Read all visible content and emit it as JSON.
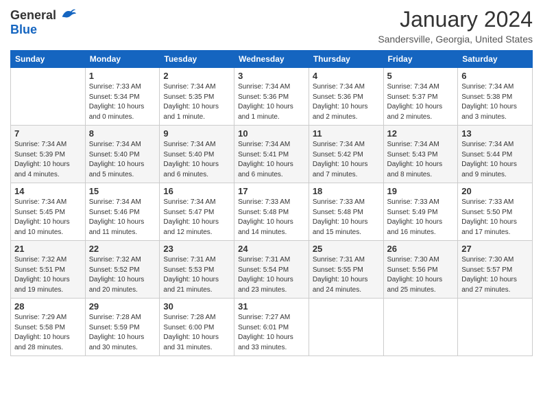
{
  "header": {
    "logo_general": "General",
    "logo_blue": "Blue",
    "month_title": "January 2024",
    "location": "Sandersville, Georgia, United States"
  },
  "weekdays": [
    "Sunday",
    "Monday",
    "Tuesday",
    "Wednesday",
    "Thursday",
    "Friday",
    "Saturday"
  ],
  "rows": [
    [
      {
        "day": "",
        "info": ""
      },
      {
        "day": "1",
        "info": "Sunrise: 7:33 AM\nSunset: 5:34 PM\nDaylight: 10 hours\nand 0 minutes."
      },
      {
        "day": "2",
        "info": "Sunrise: 7:34 AM\nSunset: 5:35 PM\nDaylight: 10 hours\nand 1 minute."
      },
      {
        "day": "3",
        "info": "Sunrise: 7:34 AM\nSunset: 5:36 PM\nDaylight: 10 hours\nand 1 minute."
      },
      {
        "day": "4",
        "info": "Sunrise: 7:34 AM\nSunset: 5:36 PM\nDaylight: 10 hours\nand 2 minutes."
      },
      {
        "day": "5",
        "info": "Sunrise: 7:34 AM\nSunset: 5:37 PM\nDaylight: 10 hours\nand 2 minutes."
      },
      {
        "day": "6",
        "info": "Sunrise: 7:34 AM\nSunset: 5:38 PM\nDaylight: 10 hours\nand 3 minutes."
      }
    ],
    [
      {
        "day": "7",
        "info": "Sunrise: 7:34 AM\nSunset: 5:39 PM\nDaylight: 10 hours\nand 4 minutes."
      },
      {
        "day": "8",
        "info": "Sunrise: 7:34 AM\nSunset: 5:40 PM\nDaylight: 10 hours\nand 5 minutes."
      },
      {
        "day": "9",
        "info": "Sunrise: 7:34 AM\nSunset: 5:40 PM\nDaylight: 10 hours\nand 6 minutes."
      },
      {
        "day": "10",
        "info": "Sunrise: 7:34 AM\nSunset: 5:41 PM\nDaylight: 10 hours\nand 6 minutes."
      },
      {
        "day": "11",
        "info": "Sunrise: 7:34 AM\nSunset: 5:42 PM\nDaylight: 10 hours\nand 7 minutes."
      },
      {
        "day": "12",
        "info": "Sunrise: 7:34 AM\nSunset: 5:43 PM\nDaylight: 10 hours\nand 8 minutes."
      },
      {
        "day": "13",
        "info": "Sunrise: 7:34 AM\nSunset: 5:44 PM\nDaylight: 10 hours\nand 9 minutes."
      }
    ],
    [
      {
        "day": "14",
        "info": "Sunrise: 7:34 AM\nSunset: 5:45 PM\nDaylight: 10 hours\nand 10 minutes."
      },
      {
        "day": "15",
        "info": "Sunrise: 7:34 AM\nSunset: 5:46 PM\nDaylight: 10 hours\nand 11 minutes."
      },
      {
        "day": "16",
        "info": "Sunrise: 7:34 AM\nSunset: 5:47 PM\nDaylight: 10 hours\nand 12 minutes."
      },
      {
        "day": "17",
        "info": "Sunrise: 7:33 AM\nSunset: 5:48 PM\nDaylight: 10 hours\nand 14 minutes."
      },
      {
        "day": "18",
        "info": "Sunrise: 7:33 AM\nSunset: 5:48 PM\nDaylight: 10 hours\nand 15 minutes."
      },
      {
        "day": "19",
        "info": "Sunrise: 7:33 AM\nSunset: 5:49 PM\nDaylight: 10 hours\nand 16 minutes."
      },
      {
        "day": "20",
        "info": "Sunrise: 7:33 AM\nSunset: 5:50 PM\nDaylight: 10 hours\nand 17 minutes."
      }
    ],
    [
      {
        "day": "21",
        "info": "Sunrise: 7:32 AM\nSunset: 5:51 PM\nDaylight: 10 hours\nand 19 minutes."
      },
      {
        "day": "22",
        "info": "Sunrise: 7:32 AM\nSunset: 5:52 PM\nDaylight: 10 hours\nand 20 minutes."
      },
      {
        "day": "23",
        "info": "Sunrise: 7:31 AM\nSunset: 5:53 PM\nDaylight: 10 hours\nand 21 minutes."
      },
      {
        "day": "24",
        "info": "Sunrise: 7:31 AM\nSunset: 5:54 PM\nDaylight: 10 hours\nand 23 minutes."
      },
      {
        "day": "25",
        "info": "Sunrise: 7:31 AM\nSunset: 5:55 PM\nDaylight: 10 hours\nand 24 minutes."
      },
      {
        "day": "26",
        "info": "Sunrise: 7:30 AM\nSunset: 5:56 PM\nDaylight: 10 hours\nand 25 minutes."
      },
      {
        "day": "27",
        "info": "Sunrise: 7:30 AM\nSunset: 5:57 PM\nDaylight: 10 hours\nand 27 minutes."
      }
    ],
    [
      {
        "day": "28",
        "info": "Sunrise: 7:29 AM\nSunset: 5:58 PM\nDaylight: 10 hours\nand 28 minutes."
      },
      {
        "day": "29",
        "info": "Sunrise: 7:28 AM\nSunset: 5:59 PM\nDaylight: 10 hours\nand 30 minutes."
      },
      {
        "day": "30",
        "info": "Sunrise: 7:28 AM\nSunset: 6:00 PM\nDaylight: 10 hours\nand 31 minutes."
      },
      {
        "day": "31",
        "info": "Sunrise: 7:27 AM\nSunset: 6:01 PM\nDaylight: 10 hours\nand 33 minutes."
      },
      {
        "day": "",
        "info": ""
      },
      {
        "day": "",
        "info": ""
      },
      {
        "day": "",
        "info": ""
      }
    ]
  ]
}
